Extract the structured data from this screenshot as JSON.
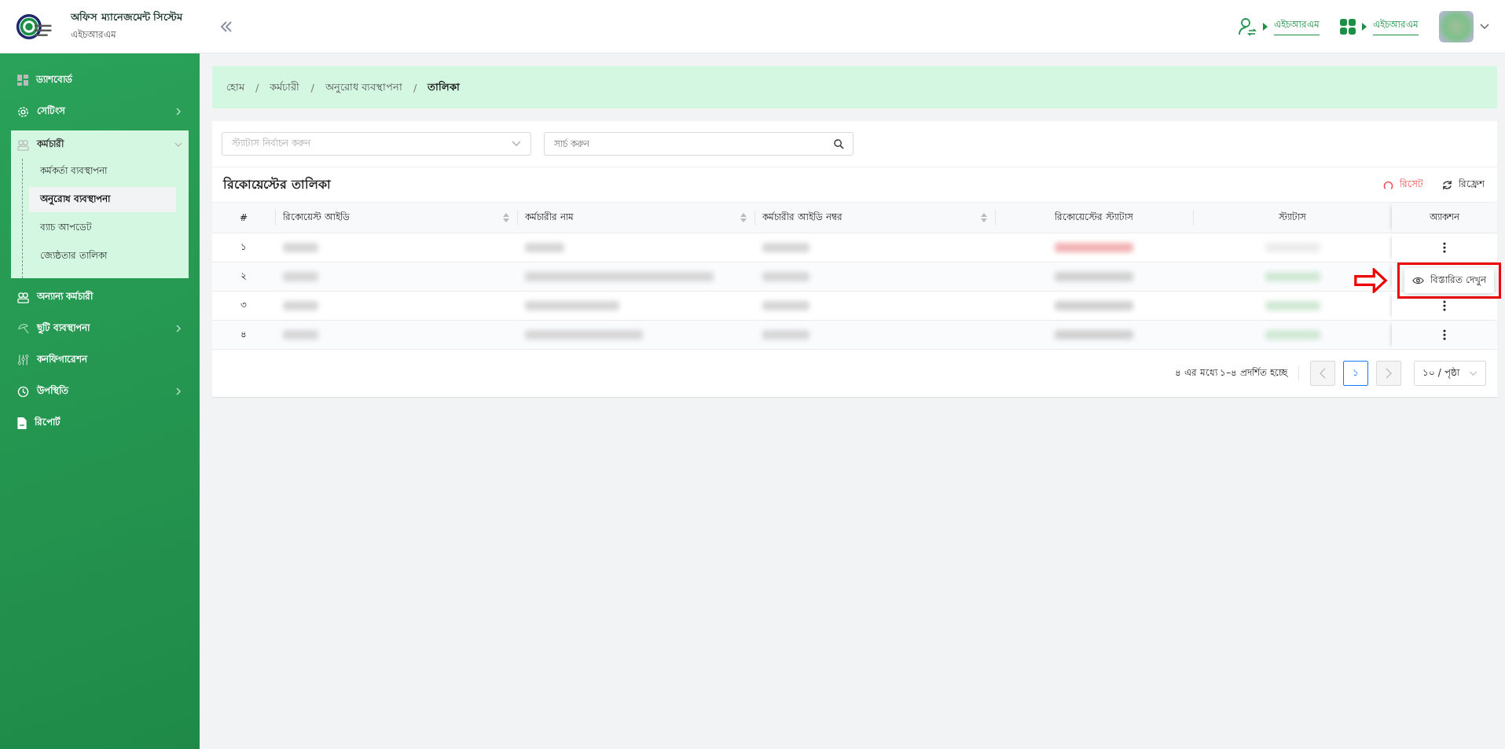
{
  "header": {
    "title": "অফিস ম্যানেজমেন্ট সিস্টেম",
    "subtitle": "এইচআরএম",
    "links": [
      {
        "kind": "user-switch",
        "label": "এইচআরএম"
      },
      {
        "kind": "apps",
        "label": "এইচআরএম"
      }
    ]
  },
  "sidebar": {
    "items": [
      {
        "kind": "dashboard",
        "label": "ড্যাশবোর্ড",
        "expandable": false,
        "expanded": false
      },
      {
        "kind": "settings",
        "label": "সেটিংস",
        "expandable": true,
        "expanded": false
      },
      {
        "kind": "staff",
        "label": "কর্মচারী",
        "expandable": true,
        "expanded": true,
        "children": [
          {
            "label": "কর্মকর্তা ব্যবস্থাপনা",
            "selected": false
          },
          {
            "label": "অনুরোধ ব্যবস্থাপনা",
            "selected": true
          },
          {
            "label": "ব্যাচ আপডেট",
            "selected": false
          },
          {
            "label": "জ্যেষ্ঠতার তালিকা",
            "selected": false
          }
        ]
      },
      {
        "kind": "staff",
        "label": "অন্যান্য কর্মচারী",
        "expandable": false,
        "expanded": false
      },
      {
        "kind": "leave",
        "label": "ছুটি ব্যবস্থাপনা",
        "expandable": true,
        "expanded": false
      },
      {
        "kind": "config",
        "label": "কনফিগারেশন",
        "expandable": false,
        "expanded": false
      },
      {
        "kind": "attendance",
        "label": "উপস্থিতি",
        "expandable": true,
        "expanded": false
      },
      {
        "kind": "report",
        "label": "রিপোর্ট",
        "expandable": false,
        "expanded": false
      }
    ]
  },
  "breadcrumb": {
    "separator": "/",
    "items": [
      "হোম",
      "কর্মচারী",
      "অনুরোধ ব্যবস্থাপনা",
      "তালিকা"
    ]
  },
  "filters": {
    "status_placeholder": "স্ট্যাটাস নির্বাচন করুন",
    "search_placeholder": "সার্চ করুন"
  },
  "table": {
    "title": "রিকোয়েস্টের তালিকা",
    "reset": "রিসেট",
    "refresh": "রিফ্রেশ",
    "columns": [
      {
        "label": "#",
        "sortable": false
      },
      {
        "label": "রিকোয়েস্ট আইডি",
        "sortable": true
      },
      {
        "label": "কর্মচারীর নাম",
        "sortable": true
      },
      {
        "label": "কর্মচারীর আইডি নম্বর",
        "sortable": true
      },
      {
        "label": "রিকোয়েস্টের স্ট্যাটাস",
        "sortable": false
      },
      {
        "label": "স্ট্যাটাস",
        "sortable": false
      },
      {
        "label": "অ্যাকশন",
        "sortable": false
      }
    ],
    "rows": [
      {
        "number": "১",
        "menu_open": false,
        "request_status": {
          "color": "#f2b3b3"
        },
        "status": {
          "color": "#ececec"
        }
      },
      {
        "number": "২",
        "menu_open": true,
        "request_status": {
          "color": "#d0d0d0"
        },
        "status": {
          "color": "#cfe8d4"
        }
      },
      {
        "number": "৩",
        "menu_open": false,
        "request_status": {
          "color": "#d0d0d0"
        },
        "status": {
          "color": "#cfe8d4"
        }
      },
      {
        "number": "৪",
        "menu_open": false,
        "request_status": {
          "color": "#d0d0d0"
        },
        "status": {
          "color": "#cfe8d4"
        }
      }
    ]
  },
  "action_menu": {
    "items": [
      "বিস্তারিত দেখুন"
    ]
  },
  "pagination": {
    "summary": "৪ এর মধ্যে ১–৪ প্রদর্শিত হচ্ছে",
    "pages": [
      {
        "label": "১",
        "selected": true
      }
    ],
    "page_size": "১০ / পৃষ্ঠা"
  }
}
